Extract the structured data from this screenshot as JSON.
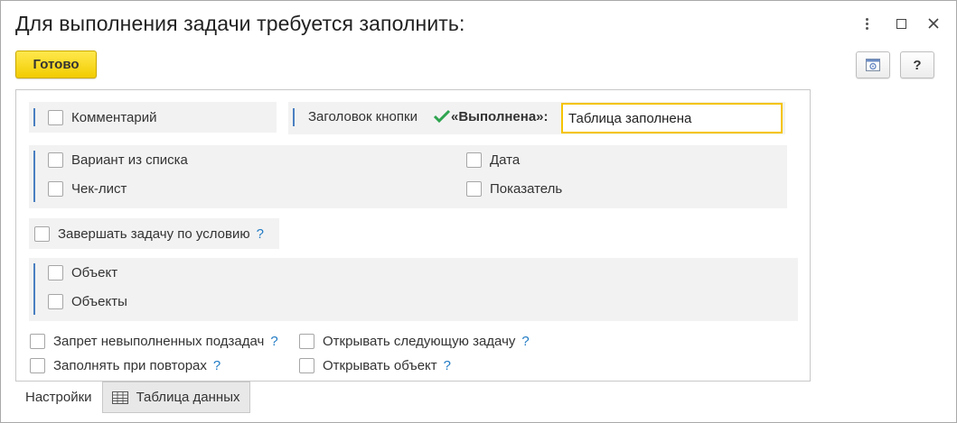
{
  "window": {
    "title": "Для выполнения задачи требуется заполнить:"
  },
  "toolbar": {
    "done_label": "Готово",
    "help_label": "?"
  },
  "fields": {
    "comment_label": "Комментарий",
    "button_caption_label": "Заголовок кнопки",
    "done_caption": "«Выполнена»:",
    "button_caption_value": "Таблица заполнена",
    "list_option_label": "Вариант из списка",
    "date_label": "Дата",
    "checklist_label": "Чек-лист",
    "indicator_label": "Показатель",
    "finish_by_condition_label": "Завершать задачу по условию",
    "object_label": "Объект",
    "objects_label": "Объекты",
    "forbid_unfinished_label": "Запрет невыполненных подзадач",
    "open_next_task_label": "Открывать следующую задачу",
    "fill_on_repeat_label": "Заполнять при повторах",
    "open_object_label": "Открывать объект",
    "help_mark": "?"
  },
  "tabs": [
    {
      "label": "Настройки",
      "active": true
    },
    {
      "label": "Таблица данных",
      "active": false
    }
  ],
  "colors": {
    "accent_yellow": "#f5c400",
    "group_bar": "#4a7fc1",
    "help_blue": "#1f7ac4",
    "check_green": "#2ea44f"
  }
}
